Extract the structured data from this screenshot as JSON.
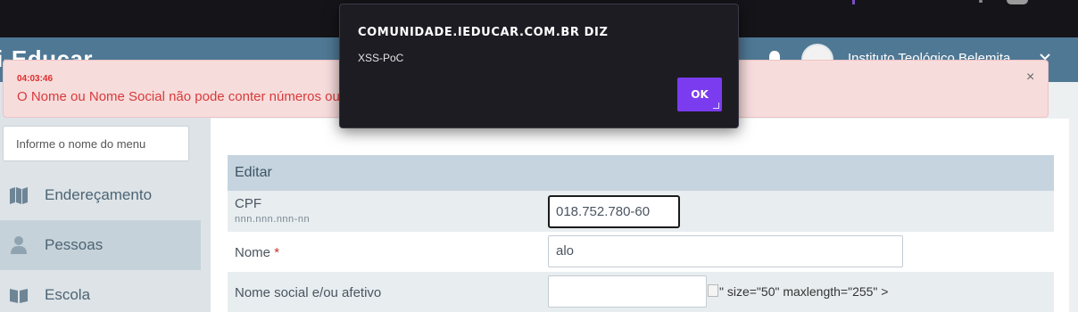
{
  "header": {
    "brand": "i-Educar",
    "user_name": "Instituto Teológico Belemita"
  },
  "alert": {
    "time": "04:03:46",
    "message": "O Nome ou Nome Social não pode conter números ou caracteres especiais",
    "close": "×"
  },
  "dialog": {
    "title": "COMUNIDADE.IEDUCAR.COM.BR DIZ",
    "message": "XSS-PoC",
    "ok": "OK"
  },
  "sidebar": {
    "search_placeholder": "Informe o nome do menu",
    "items": [
      {
        "label": "Endereçamento",
        "icon": "map-icon"
      },
      {
        "label": "Pessoas",
        "icon": "person-icon"
      },
      {
        "label": "Escola",
        "icon": "book-icon"
      }
    ]
  },
  "form": {
    "title": "Editar",
    "cpf_label": "CPF",
    "cpf_hint": "nnn.nnn.nnn-nn",
    "cpf_value": "018.752.780-60",
    "nome_label": "Nome",
    "required_mark": "*",
    "nome_value": "alo",
    "social_label": "Nome social e/ou afetivo",
    "social_value": "",
    "injected_text": "\" size=\"50\" maxlength=\"255\" >"
  },
  "colors": {
    "header": "#4f7894",
    "alert_text": "#d83a3a",
    "dialog_bg": "#1d1c23",
    "dialog_button": "#7b3cf0"
  }
}
